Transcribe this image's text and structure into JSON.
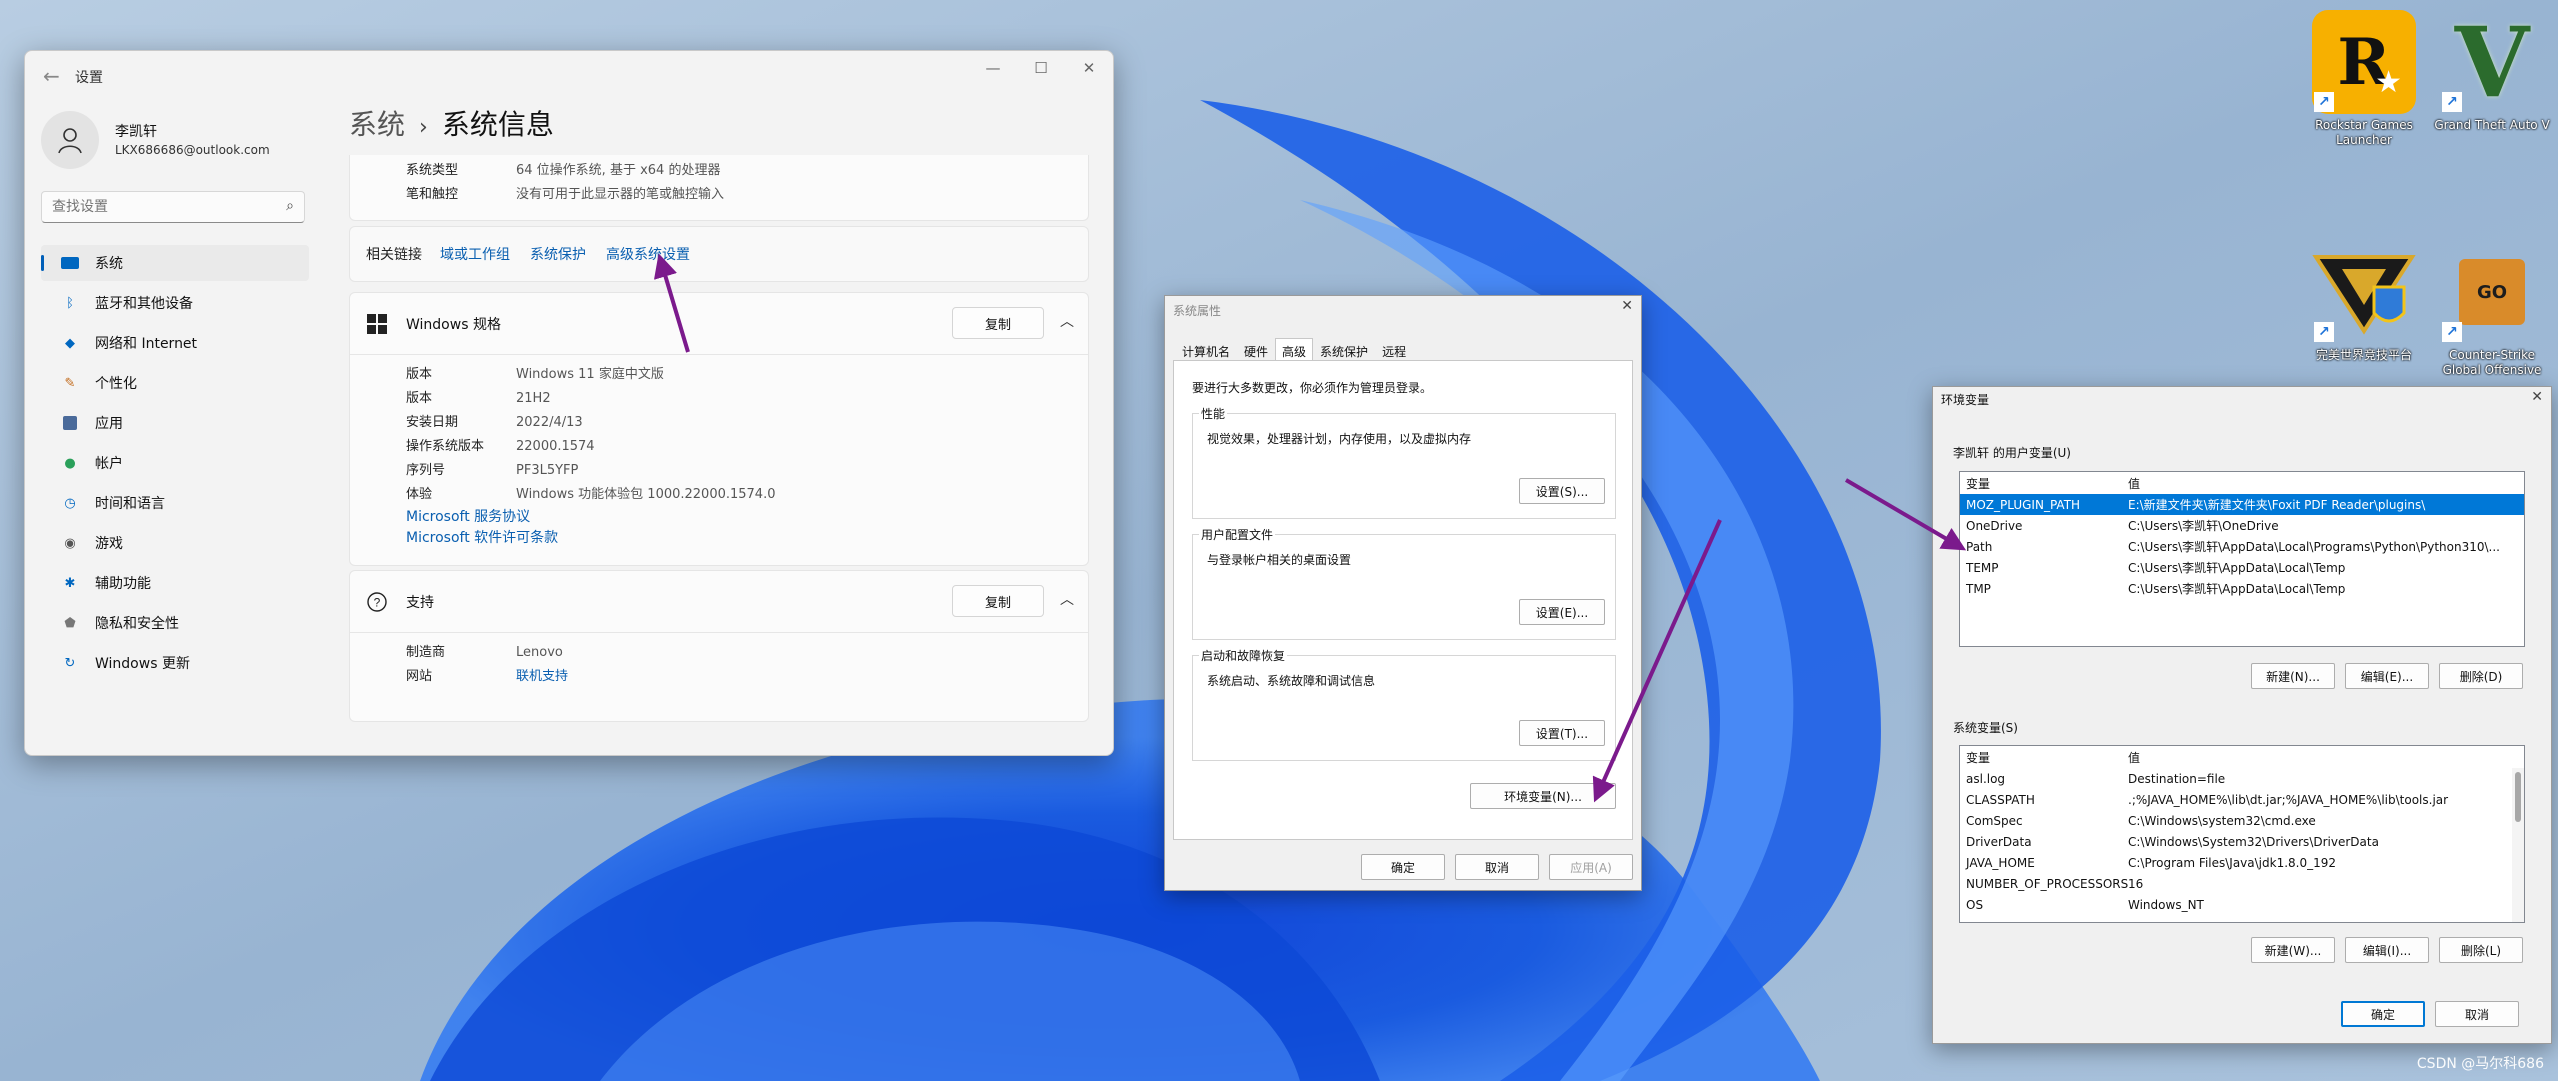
{
  "settings": {
    "window_title": "设置",
    "user": {
      "name": "李凯轩",
      "email": "LKX686686@outlook.com"
    },
    "search": {
      "placeholder": "查找设置"
    },
    "nav": [
      {
        "label": "系统",
        "icon": "monitor-icon",
        "active": true
      },
      {
        "label": "蓝牙和其他设备",
        "icon": "bluetooth-icon"
      },
      {
        "label": "网络和 Internet",
        "icon": "wifi-icon"
      },
      {
        "label": "个性化",
        "icon": "brush-icon"
      },
      {
        "label": "应用",
        "icon": "apps-icon"
      },
      {
        "label": "帐户",
        "icon": "account-icon"
      },
      {
        "label": "时间和语言",
        "icon": "globe-clock-icon"
      },
      {
        "label": "游戏",
        "icon": "gamepad-icon"
      },
      {
        "label": "辅助功能",
        "icon": "accessibility-icon"
      },
      {
        "label": "隐私和安全性",
        "icon": "shield-icon"
      },
      {
        "label": "Windows 更新",
        "icon": "update-icon"
      }
    ],
    "breadcrumb": {
      "parent": "系统",
      "current": "系统信息"
    },
    "device_specs_tail": [
      {
        "k": "系统类型",
        "v": "64 位操作系统, 基于 x64 的处理器"
      },
      {
        "k": "笔和触控",
        "v": "没有可用于此显示器的笔或触控输入"
      }
    ],
    "related_links": {
      "label": "相关链接",
      "links": [
        "域或工作组",
        "系统保护",
        "高级系统设置"
      ]
    },
    "windows_spec": {
      "title": "Windows 规格",
      "copy": "复制",
      "rows": [
        {
          "k": "版本",
          "v": "Windows 11 家庭中文版"
        },
        {
          "k": "版本",
          "v": "21H2"
        },
        {
          "k": "安装日期",
          "v": "2022/4/13"
        },
        {
          "k": "操作系统版本",
          "v": "22000.1574"
        },
        {
          "k": "序列号",
          "v": "PF3L5YFP"
        },
        {
          "k": "体验",
          "v": "Windows 功能体验包 1000.22000.1574.0"
        }
      ],
      "links": [
        "Microsoft 服务协议",
        "Microsoft 软件许可条款"
      ]
    },
    "support": {
      "title": "支持",
      "copy": "复制",
      "rows": [
        {
          "k": "制造商",
          "v": "Lenovo"
        },
        {
          "k": "网站",
          "v": "联机支持",
          "link": true
        }
      ]
    }
  },
  "sysprop": {
    "title": "系统属性",
    "tabs": [
      "计算机名",
      "硬件",
      "高级",
      "系统保护",
      "远程"
    ],
    "active_tab": 2,
    "admin_note": "要进行大多数更改，你必须作为管理员登录。",
    "groups": [
      {
        "title": "性能",
        "desc": "视觉效果，处理器计划，内存使用，以及虚拟内存",
        "button": "设置(S)..."
      },
      {
        "title": "用户配置文件",
        "desc": "与登录帐户相关的桌面设置",
        "button": "设置(E)..."
      },
      {
        "title": "启动和故障恢复",
        "desc": "系统启动、系统故障和调试信息",
        "button": "设置(T)..."
      }
    ],
    "env_button": "环境变量(N)...",
    "ok": "确定",
    "cancel": "取消",
    "apply": "应用(A)"
  },
  "envvar": {
    "title": "环境变量",
    "user_section": "李凯轩 的用户变量(U)",
    "col_var": "变量",
    "col_val": "值",
    "user_vars": [
      {
        "name": "MOZ_PLUGIN_PATH",
        "value": "E:\\新建文件夹\\新建文件夹\\Foxit PDF Reader\\plugins\\",
        "selected": true
      },
      {
        "name": "OneDrive",
        "value": "C:\\Users\\李凯轩\\OneDrive"
      },
      {
        "name": "Path",
        "value": "C:\\Users\\李凯轩\\AppData\\Local\\Programs\\Python\\Python310\\..."
      },
      {
        "name": "TEMP",
        "value": "C:\\Users\\李凯轩\\AppData\\Local\\Temp"
      },
      {
        "name": "TMP",
        "value": "C:\\Users\\李凯轩\\AppData\\Local\\Temp"
      }
    ],
    "user_buttons": [
      "新建(N)...",
      "编辑(E)...",
      "删除(D)"
    ],
    "sys_section": "系统变量(S)",
    "sys_vars": [
      {
        "name": "asl.log",
        "value": "Destination=file"
      },
      {
        "name": "CLASSPATH",
        "value": ".;%JAVA_HOME%\\lib\\dt.jar;%JAVA_HOME%\\lib\\tools.jar"
      },
      {
        "name": "ComSpec",
        "value": "C:\\Windows\\system32\\cmd.exe"
      },
      {
        "name": "DriverData",
        "value": "C:\\Windows\\System32\\Drivers\\DriverData"
      },
      {
        "name": "JAVA_HOME",
        "value": "C:\\Program Files\\Java\\jdk1.8.0_192"
      },
      {
        "name": "NUMBER_OF_PROCESSORS",
        "value": "16"
      },
      {
        "name": "OS",
        "value": "Windows_NT"
      }
    ],
    "sys_buttons": [
      "新建(W)...",
      "编辑(I)...",
      "删除(L)"
    ],
    "ok": "确定",
    "cancel": "取消"
  },
  "desktop_icons": [
    {
      "label": "Rockstar Games Launcher",
      "icon": "rockstar-icon"
    },
    {
      "label": "Grand Theft Auto V",
      "icon": "gta5-icon"
    },
    {
      "label": "完美世界竞技平台",
      "icon": "perfect-world-icon"
    },
    {
      "label": "Counter-Strike Global Offensive",
      "icon": "csgo-icon"
    }
  ],
  "watermark": "CSDN @马尔科686",
  "colors": {
    "accent": "#0078d7",
    "link": "#0a5fb0",
    "arrow": "#7b1a8c"
  }
}
